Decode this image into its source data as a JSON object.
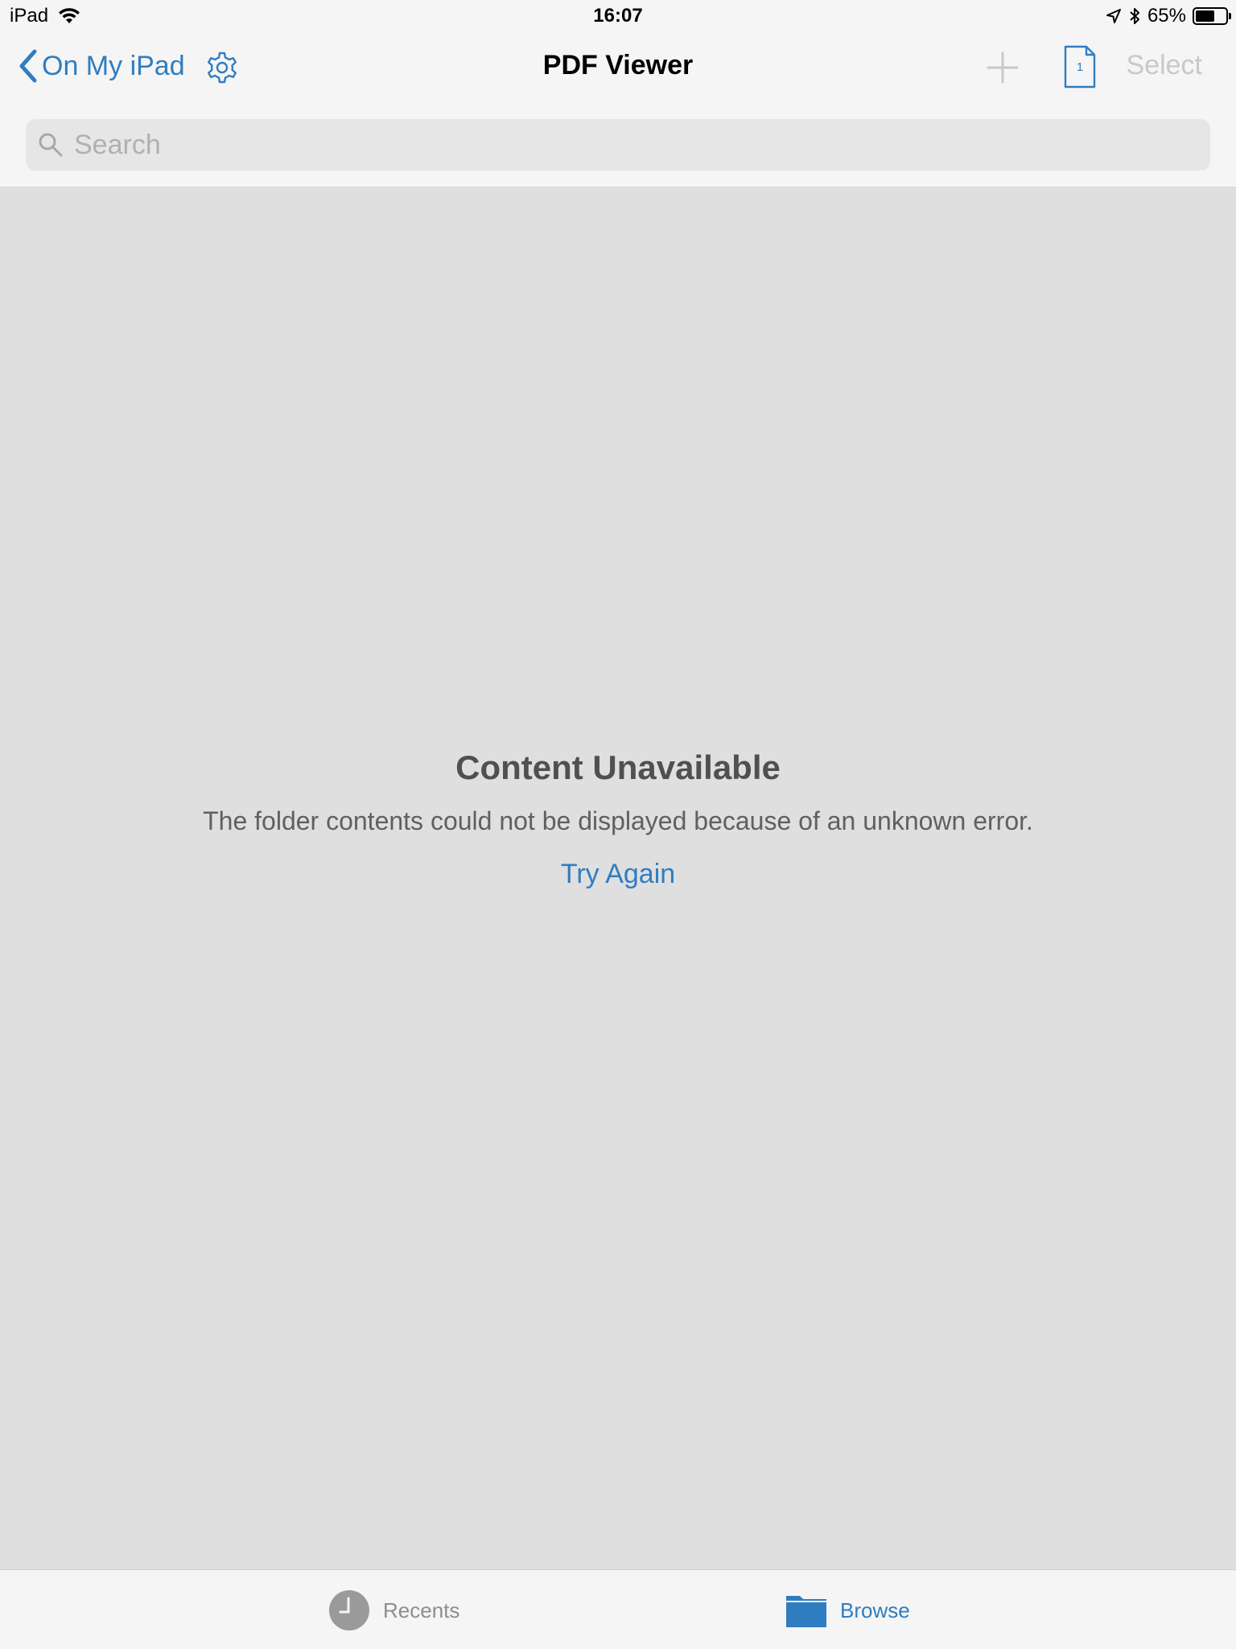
{
  "status_bar": {
    "device": "iPad",
    "time": "16:07",
    "battery_text": "65%",
    "battery_level": 0.65,
    "icons": [
      "wifi-icon",
      "location-arrow-icon",
      "bluetooth-icon",
      "battery-icon"
    ]
  },
  "nav": {
    "back_label": "On My iPad",
    "title": "PDF Viewer",
    "page_badge": "1",
    "select_label": "Select",
    "icons": [
      "chevron-left-icon",
      "gear-icon",
      "plus-icon",
      "document-page-icon"
    ]
  },
  "search": {
    "placeholder": "Search",
    "value": ""
  },
  "empty_state": {
    "title": "Content Unavailable",
    "message": "The folder contents could not be displayed because of an unknown error.",
    "action_label": "Try Again"
  },
  "tab_bar": {
    "tabs": [
      {
        "label": "Recents",
        "icon": "clock-icon",
        "selected": false
      },
      {
        "label": "Browse",
        "icon": "folder-icon",
        "selected": true
      }
    ]
  },
  "colors": {
    "accent": "#2f7dc1",
    "background": "#dfdfdf",
    "chrome": "#f5f5f5",
    "disabled": "#c8c8c8"
  }
}
